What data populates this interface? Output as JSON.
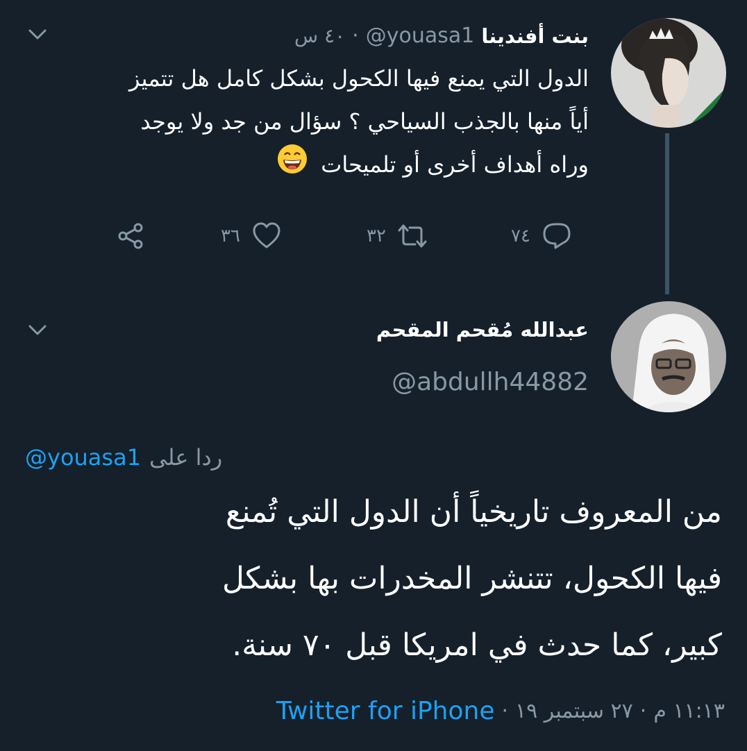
{
  "parent_tweet": {
    "display_name": "بنت أفندينا",
    "handle": "@youasa1",
    "time": "٤٠ س",
    "separator": "·",
    "text_lines": [
      "الدول التي يمنع فيها الكحول بشكل كامل هل تتميز",
      "أياً منها بالجذب السياحي ؟ سؤال من جد ولا يوجد",
      "وراه أهداف أخرى أو تلميحات"
    ],
    "emoji": "😄",
    "actions": {
      "reply_count": "٧٤",
      "retweet_count": "٣٢",
      "like_count": "٣٦"
    }
  },
  "main_tweet": {
    "display_name": "عبدالله مُقحم المقحم",
    "handle": "@abdullh44882",
    "reply_prefix": "ردا على",
    "reply_to": "@youasa1",
    "text_lines": [
      "من المعروف تاريخياً أن الدول التي تُمنع",
      "فيها الكحول،  تتنشر المخدرات بها بشكل",
      "كبير، كما حدث في امريكا قبل ٧٠ سنة."
    ],
    "time": "١١:١٣ م",
    "date": "٢٧ سبتمبر ١٩",
    "separator": "·",
    "source": "Twitter for iPhone"
  },
  "colors": {
    "background": "#15202b",
    "secondary_text": "#8899a6",
    "link": "#1da1f2",
    "thread_line": "#3d5466"
  },
  "icons": [
    "chevron-down-icon",
    "reply-icon",
    "retweet-icon",
    "like-icon",
    "share-icon"
  ]
}
